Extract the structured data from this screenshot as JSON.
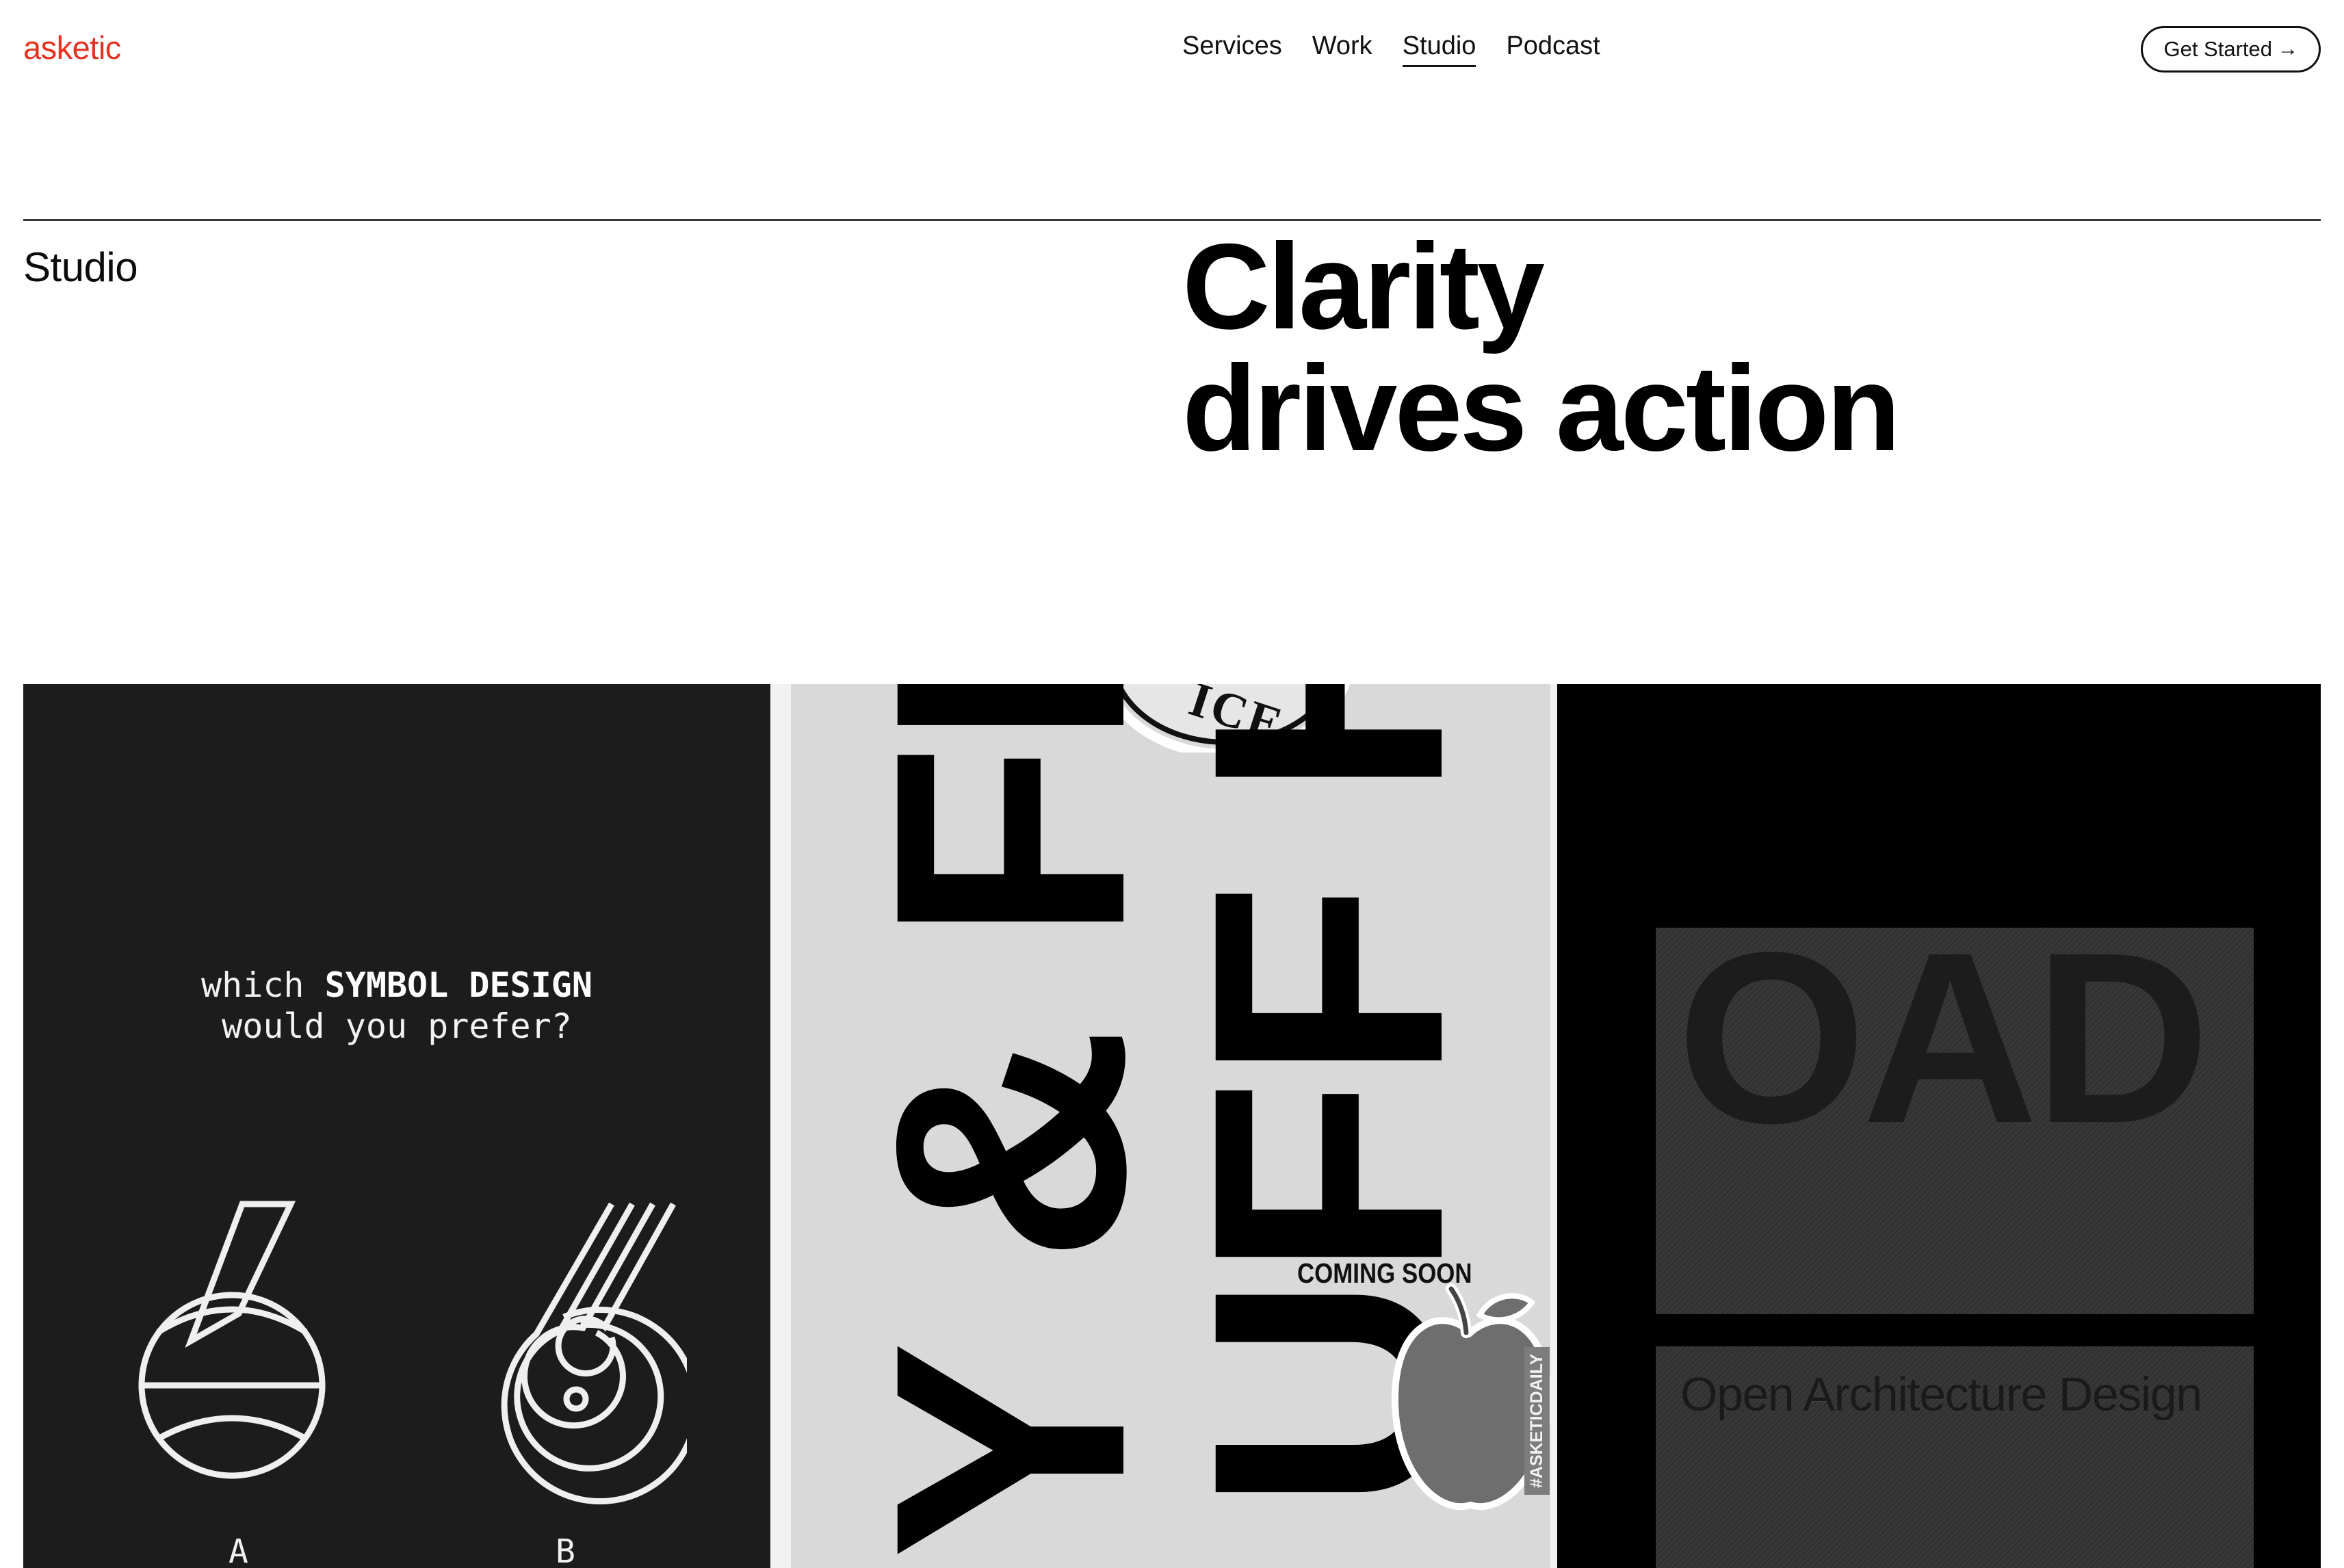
{
  "brand": {
    "logo": "asketic",
    "accent_color": "#e5321f"
  },
  "nav": {
    "items": [
      {
        "label": "Services",
        "active": false
      },
      {
        "label": "Work",
        "active": false
      },
      {
        "label": "Studio",
        "active": true
      },
      {
        "label": "Podcast",
        "active": false
      }
    ],
    "cta_label": "Get Started",
    "cta_icon": "arrow-right-icon"
  },
  "hero": {
    "section_label": "Studio",
    "headline_line1": "Clarity",
    "headline_line2": "drives action"
  },
  "gallery": {
    "card1": {
      "question_prefix": "which",
      "question_bold": "SYMBOL DESIGN",
      "question_line2": "would you prefer?",
      "option_a": "A",
      "option_b": "B"
    },
    "card2": {
      "poster_line1": "Y & FRESH",
      "poster_line2": "UFF HERE",
      "badge_text": "ICE",
      "coming_soon": "COMING SOON",
      "hashtag": "#ASKETICDAILY"
    },
    "card3": {
      "mark": "OAD",
      "subtitle": "Open Architecture Design"
    }
  }
}
